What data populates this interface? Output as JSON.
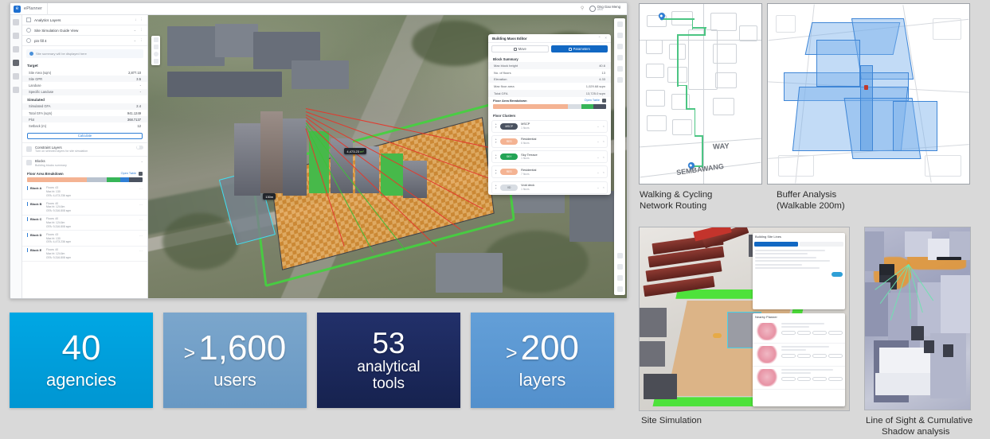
{
  "app": {
    "name": "ePlanner",
    "user": {
      "name": "Ong Gao Meng",
      "role": "URA"
    },
    "titlebar_icons": [
      "search-icon",
      "help-icon"
    ]
  },
  "rail": {
    "items": [
      {
        "name": "layers-icon"
      },
      {
        "name": "grid-icon"
      },
      {
        "name": "measure-icon"
      },
      {
        "name": "analytics-icon"
      },
      {
        "name": "chart-icon"
      },
      {
        "name": "table-icon"
      }
    ]
  },
  "left_panel": {
    "rows": [
      {
        "label": "Analytics Layers",
        "tail": "↓"
      },
      {
        "label": "Site Simulation Guide View",
        "tail": "∨"
      },
      {
        "label": "pin fill 4",
        "tail": "∨"
      }
    ],
    "note": "Site summary will be displayed here",
    "target": {
      "heading": "Target",
      "rows": [
        {
          "k": "Site Area (sqm)",
          "v": "2,877.10"
        },
        {
          "k": "Site GPR",
          "v": "3.5"
        },
        {
          "k": "Landuse",
          "v": "-"
        },
        {
          "k": "Specific Landuse",
          "v": "-"
        }
      ]
    },
    "simulated": {
      "heading": "Simulated",
      "rows": [
        {
          "k": "Simulated GFA",
          "v": "2.4"
        },
        {
          "k": "Total GFA (sqm)",
          "v": "941.1249"
        },
        {
          "k": "Plot",
          "v": "368.7137"
        },
        {
          "k": "Setback (m)",
          "v": "12"
        }
      ]
    },
    "calc_button": "Calculate",
    "constraint": {
      "title": "Constraint Layers",
      "subtitle": "Turn on selected layers for site simulation"
    },
    "blocks_entry": {
      "title": "Blocks",
      "subtitle": "Building blocks summary"
    },
    "floor_area": {
      "title": "Floor Area Breakdown",
      "open_table": "Open Table",
      "segments": [
        {
          "color": "#f4b393",
          "pct": 52
        },
        {
          "color": "#b9c3cf",
          "pct": 17
        },
        {
          "color": "#37b558",
          "pct": 12
        },
        {
          "color": "#2f7fd6",
          "pct": 7
        },
        {
          "color": "#4a5260",
          "pct": 12
        }
      ]
    },
    "blocks": [
      {
        "tag": "Block A",
        "l1": "Floors: 43",
        "l2": "Max ht: 130",
        "l3": "GFA: 4,473.236 sqm"
      },
      {
        "tag": "Block B",
        "l1": "Floors: 40",
        "l2": "Max ht: 124.6m",
        "l3": "GFA: 9,316.808 sqm"
      },
      {
        "tag": "Block C",
        "l1": "Floors: 40",
        "l2": "Max ht: 124.6m",
        "l3": "GFA: 9,316.808 sqm"
      },
      {
        "tag": "Block D",
        "l1": "Floors: 43",
        "l2": "Max ht: 130",
        "l3": "GFA: 4,473.236 sqm"
      },
      {
        "tag": "Block E",
        "l1": "Floors: 40",
        "l2": "Max ht: 124.6m",
        "l3": "GFA: 9,316.808 sqm"
      }
    ]
  },
  "viewport": {
    "tooltips": [
      {
        "text": "4,473.23",
        "hl": "m²"
      },
      {
        "text": "130m"
      }
    ],
    "left_tools": [
      "zoom-in-icon",
      "zoom-out-icon",
      "pin-icon",
      "compass-icon"
    ],
    "right_tools": [
      "layers-icon",
      "search-icon",
      "box-icon",
      "building-icon",
      "filter-icon",
      "circle-icon",
      "target-icon",
      "terrain-icon",
      "link-icon",
      "settings-icon"
    ]
  },
  "mass_editor": {
    "title": "Building Mass Editor",
    "tabs": [
      {
        "label": "Move",
        "icon": "move-icon",
        "active": false
      },
      {
        "label": "Parameters",
        "icon": "sliders-icon",
        "active": true
      }
    ],
    "summary_heading": "Block Summary",
    "summary": [
      {
        "k": "Max block height",
        "v": "40.6"
      },
      {
        "k": "No. of floors",
        "v": "13"
      },
      {
        "k": "Elevation",
        "v": "4.33"
      },
      {
        "k": "Max floor area",
        "v": "1,029.68 sqm"
      },
      {
        "k": "Total GFA",
        "v": "13,725.0 sqm"
      }
    ],
    "fa_title": "Floor Area Breakdown",
    "fa_link": "Open Table",
    "fa_segments": [
      {
        "color": "#f4b393",
        "pct": 66
      },
      {
        "color": "#d8dde3",
        "pct": 12
      },
      {
        "color": "#37b558",
        "pct": 11
      },
      {
        "color": "#4a5260",
        "pct": 11
      }
    ],
    "clusters_heading": "Floor Clusters",
    "clusters": [
      {
        "pill": "MSCP",
        "color": "#4a5260",
        "name": "MSCP",
        "sub": "1 floors"
      },
      {
        "pill": "RES",
        "color": "#f4b393",
        "name": "Residential",
        "sub": "6 floors"
      },
      {
        "pill": "SKY",
        "color": "#23a455",
        "name": "Sky Terrace",
        "sub": "1 floors"
      },
      {
        "pill": "RES",
        "color": "#f4b393",
        "name": "Residential",
        "sub": "7 floors"
      },
      {
        "pill": "VD",
        "color": "#d8dde3",
        "name": "Void deck",
        "sub": "1 floors"
      }
    ]
  },
  "stats": [
    {
      "prefix": "",
      "number": "40",
      "label": "agencies",
      "color": "#00a0dd",
      "compact": false
    },
    {
      "prefix": ">",
      "number": "1,600",
      "label": "users",
      "color": "#6e9fc9",
      "compact": false
    },
    {
      "prefix": "",
      "number": "53",
      "label": "analytical\ntools",
      "label_l1": "analytical",
      "label_l2": "tools",
      "color": "#1b2a5e",
      "compact": true
    },
    {
      "prefix": ">",
      "number": "200",
      "label": "layers",
      "color": "#5b9bd5",
      "compact": false
    }
  ],
  "thumbnails": [
    {
      "id": "walking-cycling",
      "caption_l1": "Walking & Cycling",
      "caption_l2": "Network Routing",
      "map_labels": [
        "WAY",
        "SEMBAWANG"
      ],
      "route_color": "#4cc583",
      "pin_color": "#2f7fd6"
    },
    {
      "id": "buffer-analysis",
      "caption_l1": "Buffer Analysis",
      "caption_l2": "(Walkable 200m)",
      "buffer_color": "#3f86d6",
      "marker_color": "#c0392b"
    },
    {
      "id": "site-simulation",
      "caption_l1": "Site Simulation",
      "caption_l2": "",
      "panel_title": "Building Site Lines",
      "panel_tabs": [
        "Move",
        "Placement"
      ],
      "panel_section": "Nearby Planner"
    },
    {
      "id": "line-of-sight",
      "caption_l1": "Line of Sight & Cumulative",
      "caption_l2": "Shadow analysis",
      "ray_color": "#6ee3b0",
      "shadow_color": "#eb9628"
    }
  ]
}
